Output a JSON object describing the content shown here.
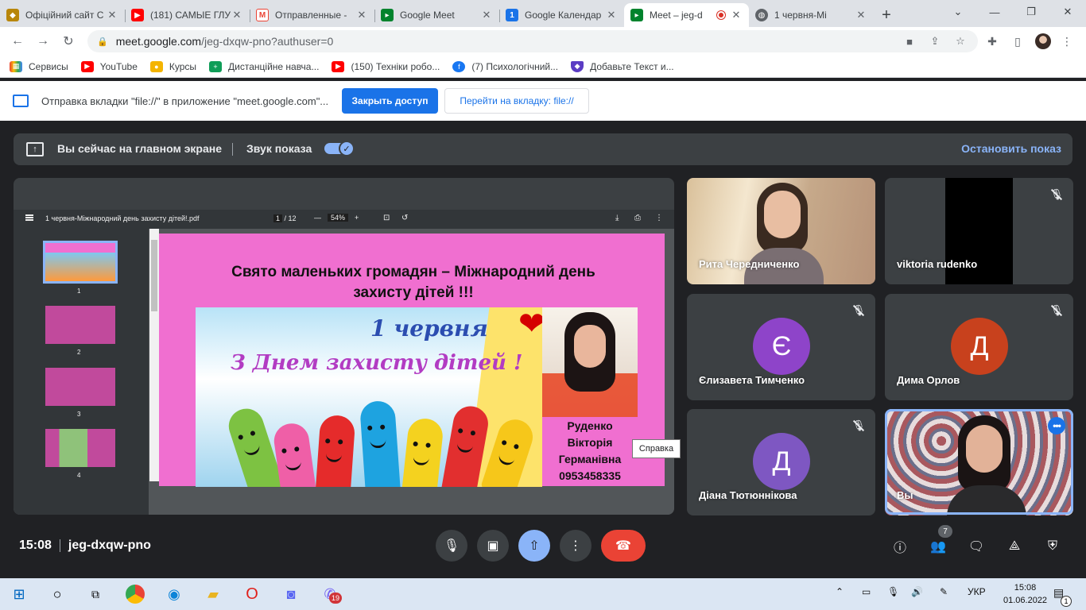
{
  "browser": {
    "tabs": [
      {
        "title": "Офіційний сайт С",
        "favicon_color": "#b8860b"
      },
      {
        "title": "(181) САМЫЕ ГЛУ",
        "favicon_color": "#ff0000"
      },
      {
        "title": "Отправленные -",
        "favicon_color": "#ea4335"
      },
      {
        "title": "Google Meet",
        "favicon_color": "#00832d"
      },
      {
        "title": "Google Календар",
        "favicon_color": "#1a73e8"
      },
      {
        "title": "Meet – jeg-d",
        "favicon_color": "#00832d"
      },
      {
        "title": "1 червня-Мі",
        "favicon_color": "#5f6368"
      }
    ],
    "url_host": "meet.google.com",
    "url_path": "/jeg-dxqw-pno?authuser=0",
    "bookmarks": [
      {
        "label": "Сервисы",
        "color": "#ea4335"
      },
      {
        "label": "YouTube",
        "color": "#ff0000"
      },
      {
        "label": "Курсы",
        "color": "#f4b400"
      },
      {
        "label": "Дистанційне навча...",
        "color": "#0f9d58"
      },
      {
        "label": "(150) Техніки робо...",
        "color": "#ff0000"
      },
      {
        "label": "(7) Психологічний...",
        "color": "#1877f2"
      },
      {
        "label": "Добавьте Текст и...",
        "color": "#5b3cc4"
      }
    ],
    "notification": {
      "message": "Отправка вкладки \"file://\" в приложение \"meet.google.com\"...",
      "primary_button": "Закрыть доступ",
      "secondary_button": "Перейти на вкладку: file://"
    }
  },
  "meet": {
    "presentation_banner": {
      "text": "Вы сейчас на главном экране",
      "audio_label": "Звук показа",
      "stop_label": "Остановить показ"
    },
    "pdf": {
      "filename": "1 червня-Міжнародний день захисту дітей!.pdf",
      "page_current": "1",
      "page_total": "/ 12",
      "zoom": "54%",
      "thumbnails": [
        "1",
        "2",
        "3",
        "4"
      ]
    },
    "slide": {
      "title_line1": "Свято маленьких громадян – Міжнародний день",
      "title_line2": "захисту дітей !!!",
      "banner_date": "1 червня",
      "banner_greeting": "З Днем захисту дітей !",
      "name_line1": "Руденко",
      "name_line2": "Вікторія",
      "name_line3": "Германівна",
      "phone": "0953458335"
    },
    "tooltip": "Справка",
    "participants": [
      {
        "name": "Рита Чередниченко"
      },
      {
        "name": "viktoria rudenko"
      },
      {
        "name": "Єлизавета Тимченко",
        "initial": "Є",
        "color": "#8e44c9"
      },
      {
        "name": "Дима Орлов",
        "initial": "Д",
        "color": "#c8411d"
      },
      {
        "name": "Діана Тютюннікова",
        "initial": "Д",
        "color": "#7e57c2"
      },
      {
        "name": "Вы"
      }
    ],
    "time": "15:08",
    "meeting_code": "jeg-dxqw-pno",
    "participant_count": "7"
  },
  "taskbar": {
    "lang": "УКР",
    "clock_time": "15:08",
    "clock_date": "01.06.2022",
    "viber_badge": "19",
    "notif_badge": "1"
  }
}
